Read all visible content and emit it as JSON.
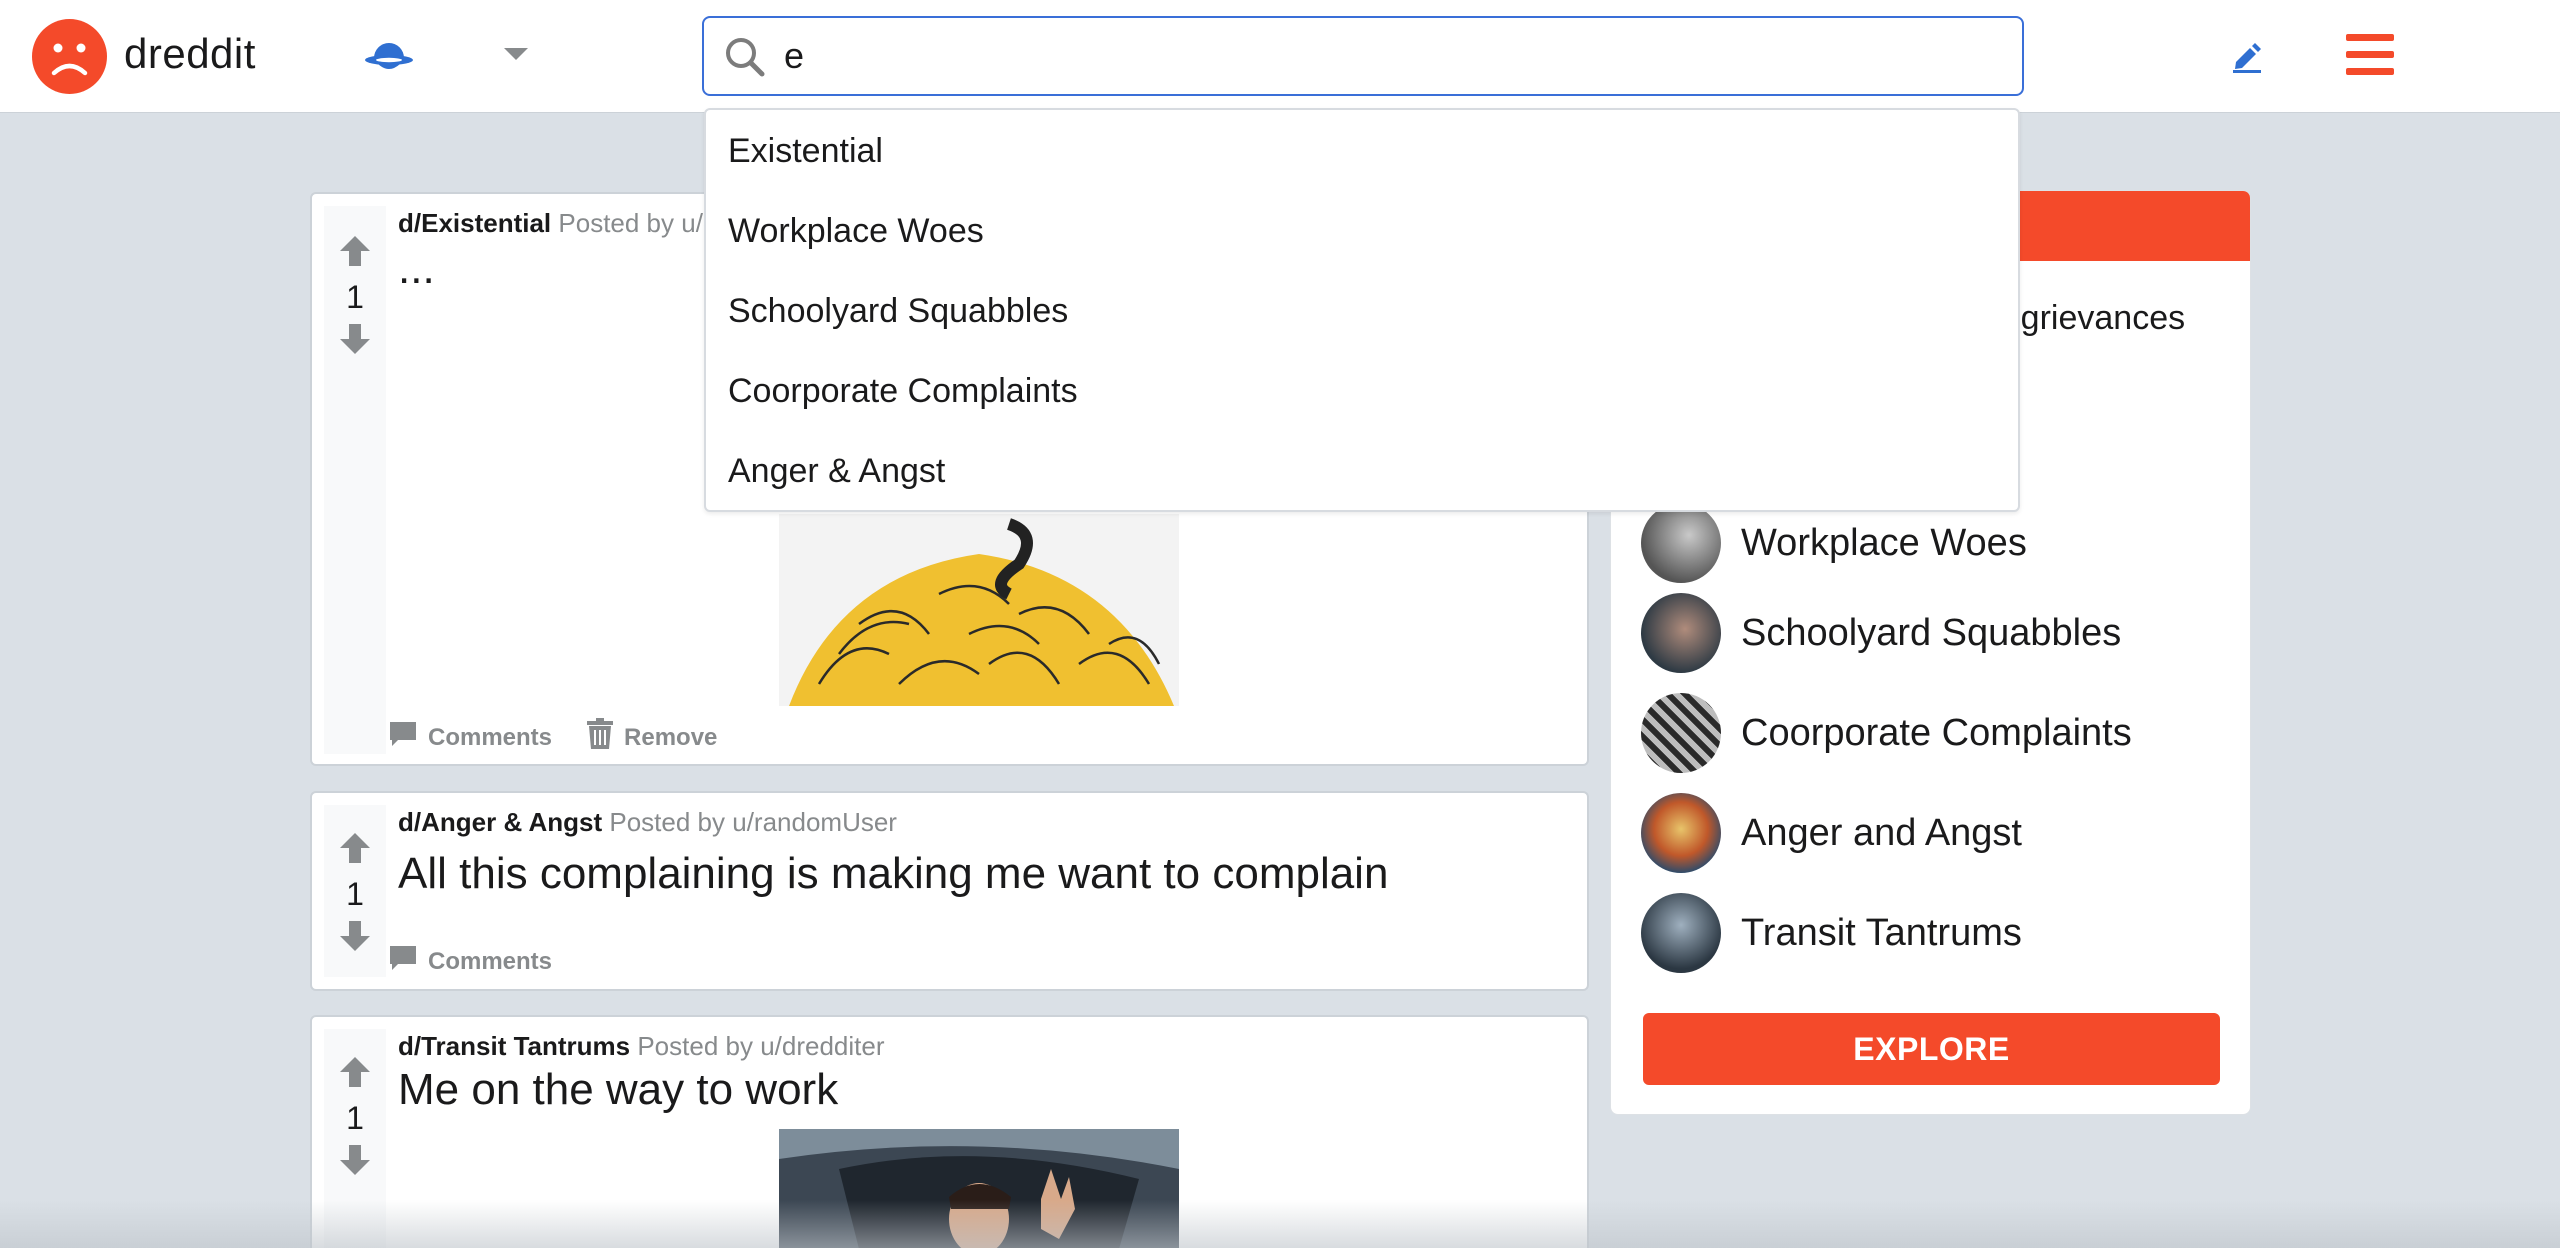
{
  "header": {
    "brand": "dreddit",
    "search_value": "e"
  },
  "search_suggestions": [
    "Existential",
    "Workplace Woes",
    "Schoolyard Squabbles",
    "Coorporate Complaints",
    "Anger & Angst"
  ],
  "posts": [
    {
      "community": "d/Existential",
      "posted_by": "Posted by u/c",
      "votes": "1",
      "title": "...",
      "actions": [
        "Comments",
        "Remove"
      ]
    },
    {
      "community": "d/Anger & Angst",
      "posted_by": "Posted by u/randomUser",
      "votes": "1",
      "title": "All this complaining is making me want to complain",
      "actions": [
        "Comments"
      ]
    },
    {
      "community": "d/Transit Tantrums",
      "posted_by": "Posted by u/dredditer",
      "votes": "1",
      "title": "Me on the way to work"
    }
  ],
  "sidebar": {
    "description_visible": "er grievances",
    "communities": [
      "Workplace Woes",
      "Schoolyard Squabbles",
      "Coorporate Complaints",
      "Anger and Angst",
      "Transit Tantrums"
    ],
    "explore_label": "EXPLORE"
  },
  "colors": {
    "brand": "#f44a2a",
    "search_border": "#3a6fd8",
    "background": "#dae0e6",
    "muted": "#878a8c"
  },
  "icons": [
    "sad-face-logo-icon",
    "community-icon",
    "chevron-down-icon",
    "search-icon",
    "pencil-icon",
    "hamburger-menu-icon",
    "upvote-icon",
    "downvote-icon",
    "comment-icon",
    "trash-icon"
  ]
}
